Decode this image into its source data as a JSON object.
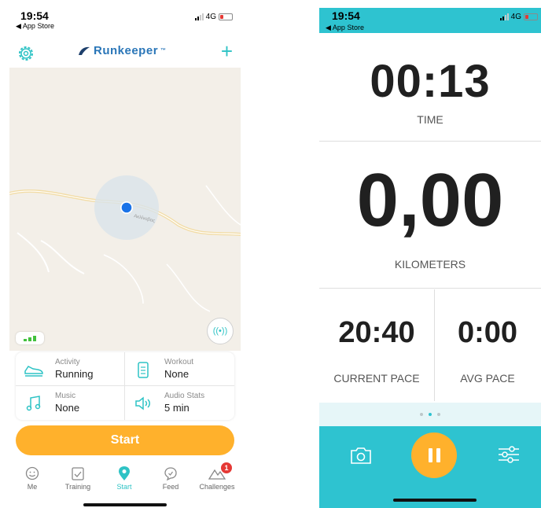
{
  "left": {
    "status": {
      "time": "19:54",
      "back": "◀ App Store",
      "network": "4G"
    },
    "header": {
      "logo": "Runkeeper",
      "trademark": "™",
      "settings_icon": "gear-icon",
      "add_icon": "plus-icon"
    },
    "map": {
      "street_label": "Ακλίνοβας"
    },
    "settings_panel": [
      {
        "label": "Activity",
        "value": "Running",
        "icon": "shoe-icon"
      },
      {
        "label": "Workout",
        "value": "None",
        "icon": "clipboard-icon"
      },
      {
        "label": "Music",
        "value": "None",
        "icon": "music-note-icon"
      },
      {
        "label": "Audio Stats",
        "value": "5 min",
        "icon": "speaker-icon"
      }
    ],
    "start_label": "Start",
    "tabs": [
      {
        "label": "Me",
        "icon": "smiley-icon"
      },
      {
        "label": "Training",
        "icon": "calendar-check-icon"
      },
      {
        "label": "Start",
        "icon": "location-pin-icon"
      },
      {
        "label": "Feed",
        "icon": "speech-bubble-icon"
      },
      {
        "label": "Challenges",
        "icon": "mountain-icon",
        "badge": "1"
      }
    ],
    "colors": {
      "accent": "#2ec3c5",
      "start": "#ffb12c",
      "gps": "#43c13d",
      "brand": "#2a76b8"
    }
  },
  "right": {
    "status": {
      "time": "19:54",
      "back": "◀ App Store",
      "network": "4G"
    },
    "time": {
      "value": "00:13",
      "label": "TIME"
    },
    "distance": {
      "value": "0,00",
      "label": "KILOMETERS"
    },
    "current_pace": {
      "value": "20:40",
      "label": "CURRENT PACE"
    },
    "avg_pace": {
      "value": "0:00",
      "label": "AVG PACE"
    },
    "page_indicator": {
      "count": 3,
      "active": 1
    },
    "colors": {
      "bar": "#2ec3d0",
      "pause": "#ffb12c"
    }
  }
}
